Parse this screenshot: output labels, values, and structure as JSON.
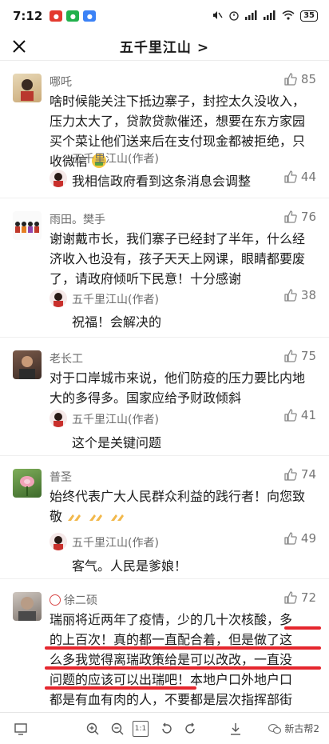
{
  "status_bar": {
    "time": "7:12",
    "app_icons": [
      "weibo-icon",
      "wechat-icon",
      "app-icon"
    ],
    "battery": "35"
  },
  "nav": {
    "title": "五千里江山 >"
  },
  "comments": [
    {
      "user": "哪吒",
      "likes": "85",
      "text": "啥时候能关注下抵边寨子，封控太久没收入，压力太大了，贷款贷款催还，想要在东方家园买个菜让他们送来后在支付现金都被拒绝，只收微信",
      "reply": {
        "author": "五千里江山(作者)",
        "text": "我相信政府看到这条消息会调整",
        "likes": "44"
      }
    },
    {
      "user": "雨田。樊手",
      "likes": "76",
      "text": "谢谢戴市长，我们寨子已经封了半年，什么经济收入也没有，孩子天天上网课，眼睛都要废了，请政府倾听下民意！十分感谢",
      "reply": {
        "author": "五千里江山(作者)",
        "text": "祝福！会解决的",
        "likes": "38"
      }
    },
    {
      "user": "老长工",
      "likes": "75",
      "text": "对于口岸城市来说，他们防疫的压力要比内地大的多得多。国家应给予财政倾斜",
      "reply": {
        "author": "五千里江山(作者)",
        "text": "这个是关键问题",
        "likes": "41"
      }
    },
    {
      "user": "普圣",
      "likes": "74",
      "text": "始终代表广大人民群众利益的践行者！向您致敬",
      "reply": {
        "author": "五千里江山(作者)",
        "text": "客气。人民是爹娘！",
        "likes": "49"
      }
    },
    {
      "user": "徐二硕",
      "likes": "72",
      "lines": [
        "瑞丽将近两年了疫情，少的几十次核酸，多",
        "的上百次！真的都一直配合着，但是做了这",
        "么多我觉得离瑞政策给是可以改改，一直没",
        "问题的应该可以出瑞吧！本地户口外地户口",
        "都是有血有肉的人，不要都是层次指挥部街"
      ]
    }
  ],
  "bottom_bar": {
    "watermark": "新古帮2",
    "page_indicator": "1:1"
  }
}
